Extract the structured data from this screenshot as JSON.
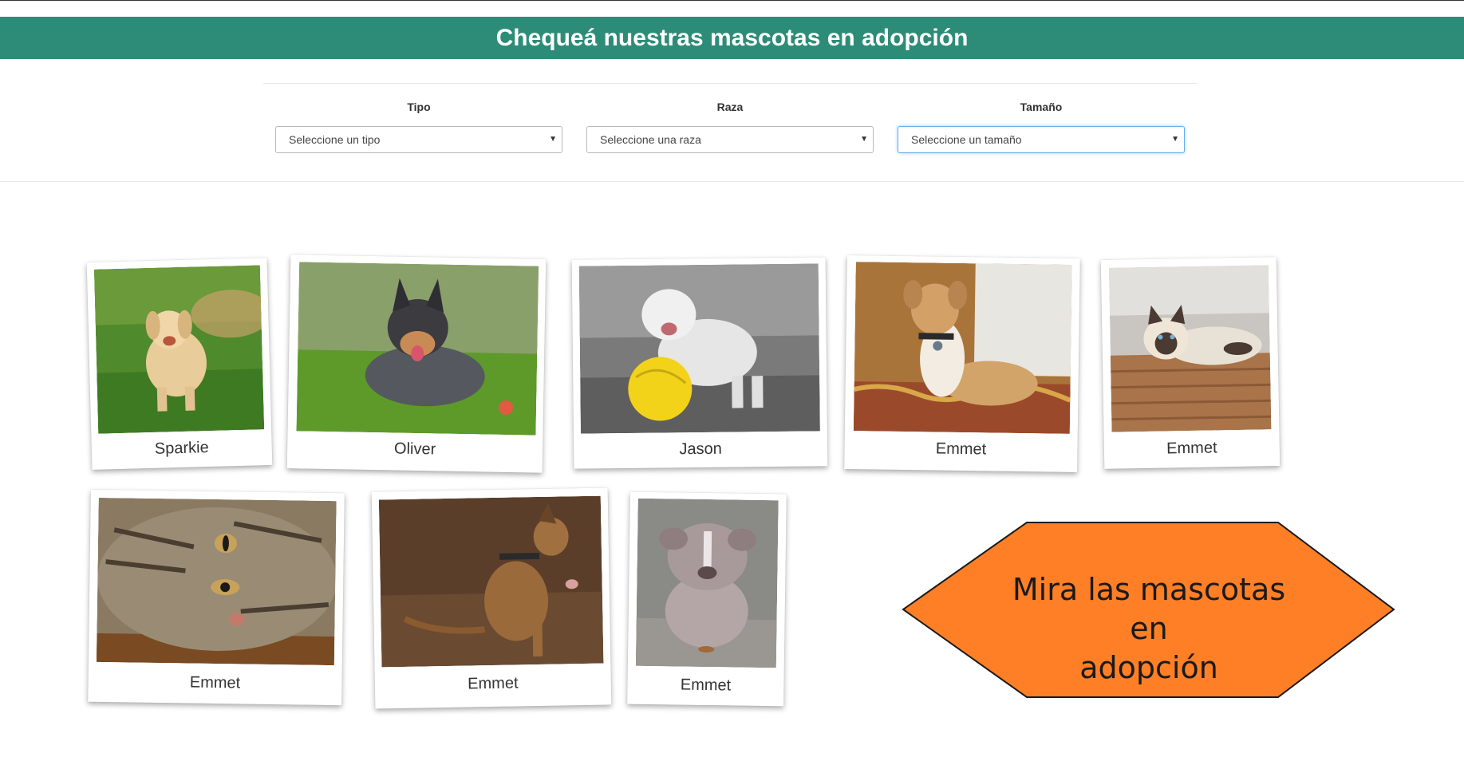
{
  "header": {
    "title": "Chequeá nuestras mascotas en adopción"
  },
  "filters": [
    {
      "label": "Tipo",
      "placeholder": "Seleccione un tipo"
    },
    {
      "label": "Raza",
      "placeholder": "Seleccione una raza"
    },
    {
      "label": "Tamaño",
      "placeholder": "Seleccione un tamaño"
    }
  ],
  "pets": [
    {
      "name": "Sparkie",
      "photo": "golden-retriever-puppy-photo"
    },
    {
      "name": "Oliver",
      "photo": "cattle-dog-photo"
    },
    {
      "name": "Jason",
      "photo": "bulldog-with-yellow-ball-photo"
    },
    {
      "name": "Emmet",
      "photo": "jack-russell-on-couch-photo"
    },
    {
      "name": "Emmet",
      "photo": "siamese-cat-photo"
    },
    {
      "name": "Emmet",
      "photo": "tabby-cat-closeup-photo"
    },
    {
      "name": "Emmet",
      "photo": "brindle-dog-sitting-photo"
    },
    {
      "name": "Emmet",
      "photo": "grey-bulldog-puppy-photo"
    }
  ],
  "cta": {
    "line1": "Mira las mascotas en",
    "line2": "adopción",
    "color": "#ff7f27"
  },
  "colors": {
    "banner": "#2d8c78",
    "focus": "#66afe9"
  }
}
